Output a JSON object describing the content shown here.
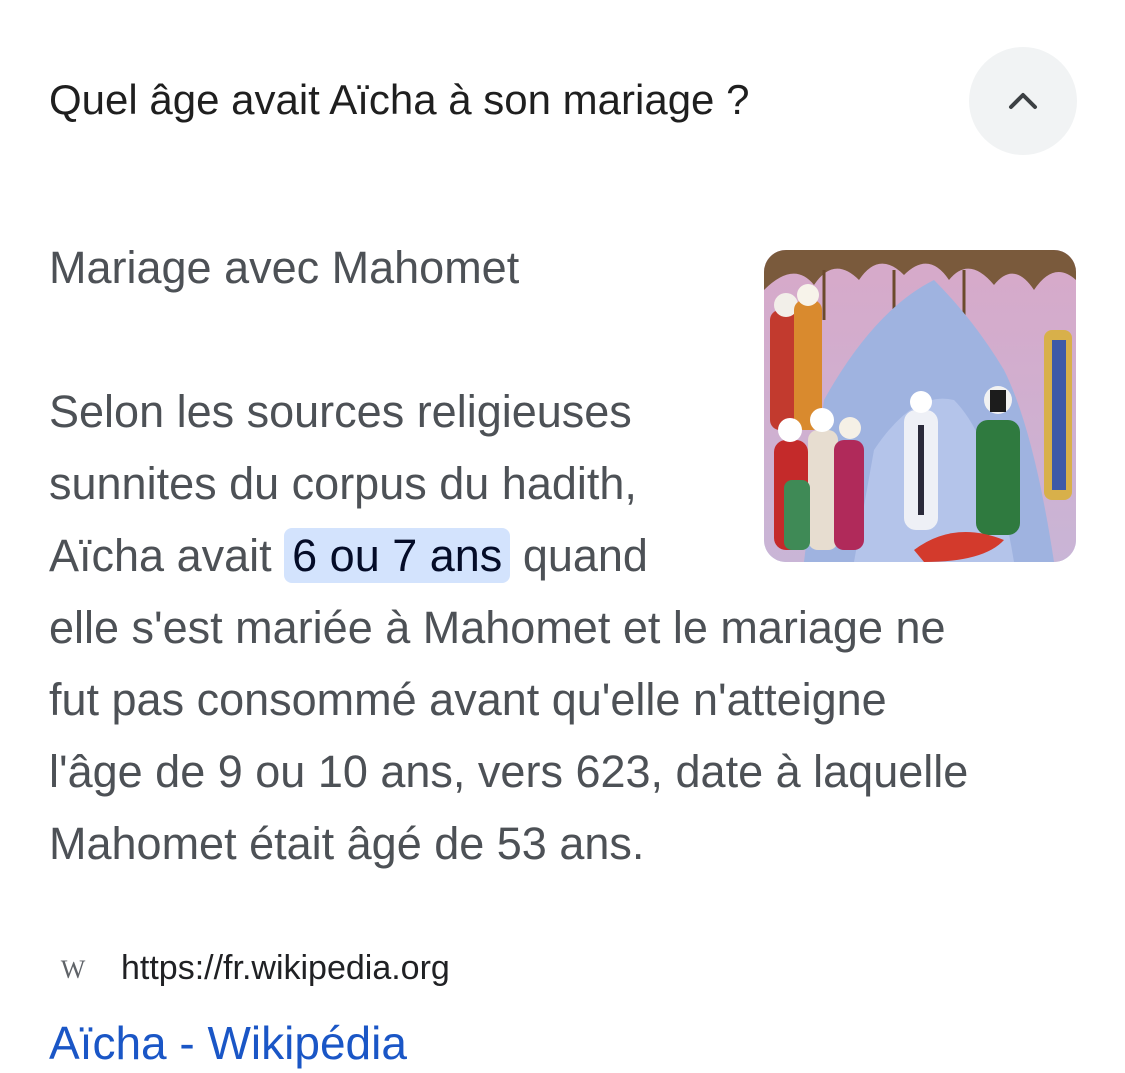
{
  "question": {
    "text": "Quel âge avait Aïcha à son mariage ?",
    "toggle_icon": "chevron-up-icon"
  },
  "answer": {
    "section_title": "Mariage avec Mahomet",
    "image_icon": "painting-thumbnail",
    "snippet": {
      "line1": "Selon les sources religieuses",
      "line2": "sunnites du corpus du hadith,",
      "line3_before": "Aïcha avait ",
      "highlight": "6 ou 7 ans",
      "line3_after": " quand",
      "line4": "elle s'est mariée à Mahomet et le mariage ne",
      "line5": "fut pas consommé avant qu'elle n'atteigne",
      "line6": "l'âge de 9 ou 10 ans, vers 623, date à laquelle",
      "line7": "Mahomet était âgé de 53 ans."
    }
  },
  "source": {
    "favicon_letter": "W",
    "url": "https://fr.wikipedia.org",
    "title": "Aïcha - Wikipédia"
  },
  "colors": {
    "highlight_bg": "#d3e3fd",
    "link": "#1a56c6",
    "toggle_bg": "#f1f3f4"
  }
}
